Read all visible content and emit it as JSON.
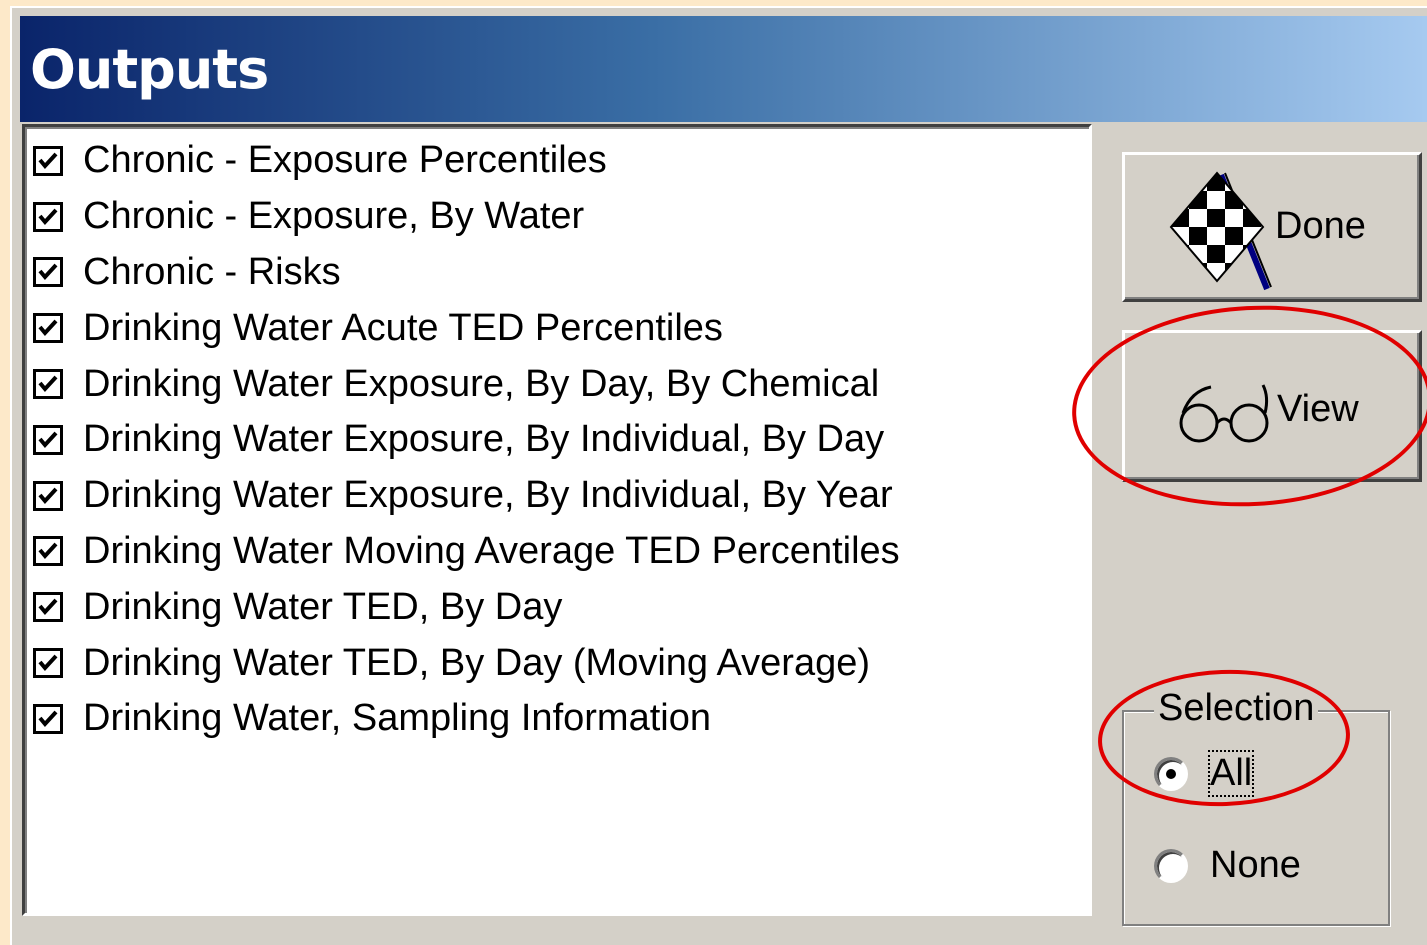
{
  "window": {
    "title": "Outputs"
  },
  "outputs": {
    "items": [
      {
        "label": "Chronic - Exposure Percentiles",
        "checked": true
      },
      {
        "label": "Chronic - Exposure, By Water",
        "checked": true
      },
      {
        "label": "Chronic - Risks",
        "checked": true
      },
      {
        "label": "Drinking Water Acute TED Percentiles",
        "checked": true
      },
      {
        "label": "Drinking Water Exposure, By Day, By Chemical",
        "checked": true
      },
      {
        "label": "Drinking Water Exposure, By Individual, By Day",
        "checked": true
      },
      {
        "label": "Drinking Water Exposure, By Individual, By Year",
        "checked": true
      },
      {
        "label": "Drinking Water Moving Average TED Percentiles",
        "checked": true
      },
      {
        "label": "Drinking Water TED, By Day",
        "checked": true
      },
      {
        "label": "Drinking Water TED, By Day (Moving Average)",
        "checked": true
      },
      {
        "label": "Drinking Water, Sampling Information",
        "checked": true
      }
    ]
  },
  "buttons": {
    "done": {
      "label": "Done",
      "icon": "checkered-flag-icon"
    },
    "view": {
      "label": "View",
      "icon": "glasses-icon"
    }
  },
  "selection": {
    "legend": "Selection",
    "options": [
      {
        "label": "All",
        "selected": true
      },
      {
        "label": "None",
        "selected": false
      }
    ]
  },
  "colors": {
    "titlebar_start": "#0A246A",
    "titlebar_end": "#A6CAF0",
    "dialog_face": "#D4D0C8",
    "annotation": "#E00000",
    "page_background": "#FDE9C9"
  }
}
